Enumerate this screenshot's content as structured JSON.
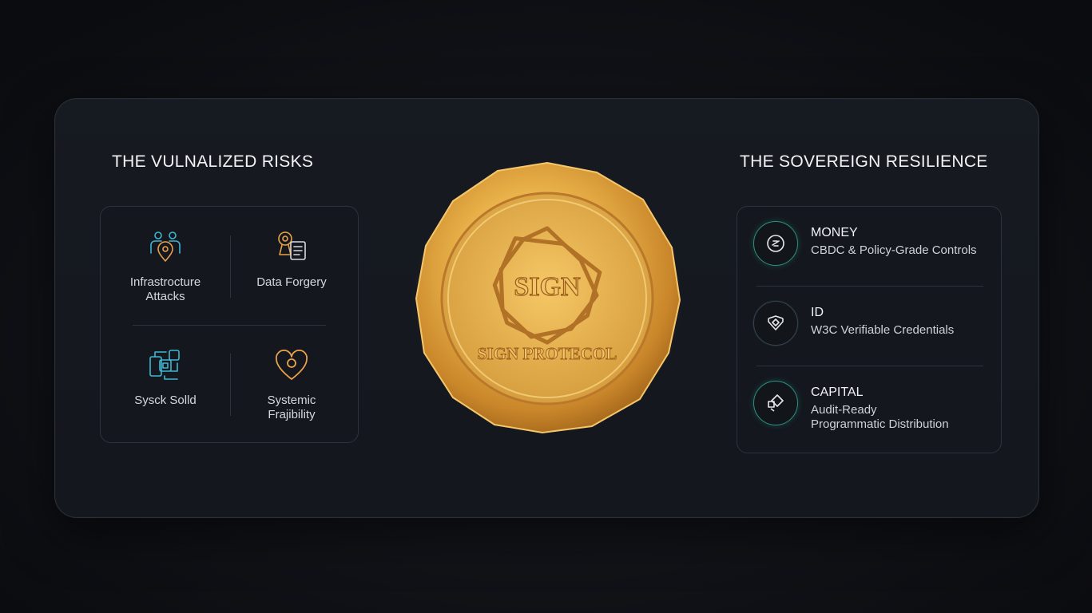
{
  "left": {
    "heading": "THE VULNALIZED RISKS",
    "items": [
      {
        "label": "Infrastrocture\nAttacks",
        "icon": "people-location-icon"
      },
      {
        "label": "Data Forgery",
        "icon": "document-seal-icon"
      },
      {
        "label": "Sysck Solld",
        "icon": "circuit-chip-icon"
      },
      {
        "label": "Systemic\nFrajibility",
        "icon": "heart-shield-icon"
      }
    ]
  },
  "center": {
    "seal_text_top": "SIGN",
    "seal_text_bottom": "SIGN PROTECOL",
    "seal_color": "#e0a93a"
  },
  "right": {
    "heading": "THE SOVEREIGN RESILIENCE",
    "items": [
      {
        "title": "MONEY",
        "desc": "CBDC & Policy-Grade Controls",
        "icon": "money-coin-icon"
      },
      {
        "title": "ID",
        "desc": "W3C Verifiable Credentials",
        "icon": "id-shield-icon"
      },
      {
        "title": "CAPITAL",
        "desc": "Audit-Ready\nProgrammatic Distribution",
        "icon": "capital-diamond-icon"
      }
    ]
  },
  "colors": {
    "accent_teal": "#3cc8aa",
    "accent_gold": "#e9b24a",
    "panel_bg": "#15181e"
  }
}
